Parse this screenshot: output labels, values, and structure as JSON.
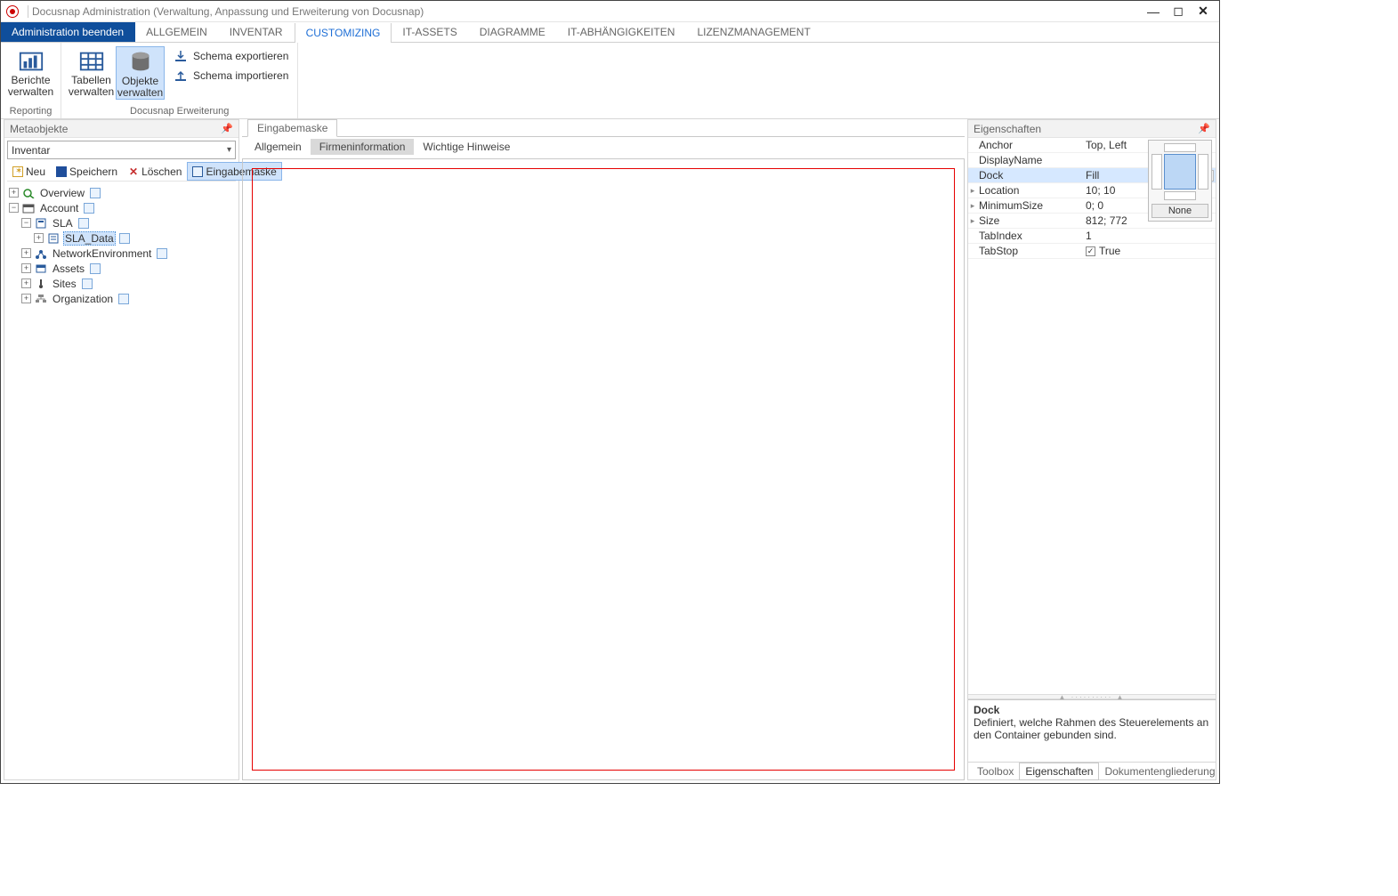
{
  "window": {
    "title": "Docusnap Administration (Verwaltung, Anpassung und Erweiterung von Docusnap)"
  },
  "menu": {
    "primary": "Administration beenden",
    "tabs": [
      "ALLGEMEIN",
      "INVENTAR",
      "CUSTOMIZING",
      "IT-ASSETS",
      "DIAGRAMME",
      "IT-ABHÄNGIGKEITEN",
      "LIZENZMANAGEMENT"
    ],
    "active": "CUSTOMIZING"
  },
  "ribbon": {
    "group_reporting": {
      "caption": "Reporting",
      "berichte": "Berichte verwalten"
    },
    "group_ext": {
      "caption": "Docusnap Erweiterung",
      "tabellen": "Tabellen verwalten",
      "objekte": "Objekte verwalten",
      "schema_export": "Schema exportieren",
      "schema_import": "Schema importieren"
    }
  },
  "left_panel": {
    "title": "Metaobjekte",
    "combo": "Inventar",
    "toolbar": {
      "neu": "Neu",
      "speichern": "Speichern",
      "loeschen": "Löschen",
      "eingabemaske": "Eingabemaske"
    },
    "tree": {
      "overview": "Overview",
      "account": "Account",
      "sla": "SLA",
      "sla_data": "SLA_Data",
      "network": "NetworkEnvironment",
      "assets": "Assets",
      "sites": "Sites",
      "organization": "Organization"
    }
  },
  "center": {
    "main_tab": "Eingabemaske",
    "subtabs": [
      "Allgemein",
      "Firmeninformation",
      "Wichtige Hinweise"
    ],
    "subtab_active": "Firmeninformation"
  },
  "right_panel": {
    "title": "Eigenschaften",
    "rows": [
      {
        "name": "Anchor",
        "value": "Top, Left"
      },
      {
        "name": "DisplayName",
        "value": ""
      },
      {
        "name": "Dock",
        "value": "Fill",
        "selected": true,
        "dropdown": true
      },
      {
        "name": "Location",
        "value": "10; 10",
        "expand": true
      },
      {
        "name": "MinimumSize",
        "value": "0; 0",
        "expand": true
      },
      {
        "name": "Size",
        "value": "812; 772",
        "expand": true
      },
      {
        "name": "TabIndex",
        "value": "1"
      },
      {
        "name": "TabStop",
        "value": "True",
        "checkbox": true
      }
    ],
    "dock_none": "None",
    "desc_title": "Dock",
    "desc_text": "Definiert, welche Rahmen des Steuerelements an den Container gebunden sind.",
    "bottom_tabs": [
      "Toolbox",
      "Eigenschaften",
      "Dokumentengliederung"
    ],
    "bottom_active": "Eigenschaften"
  }
}
